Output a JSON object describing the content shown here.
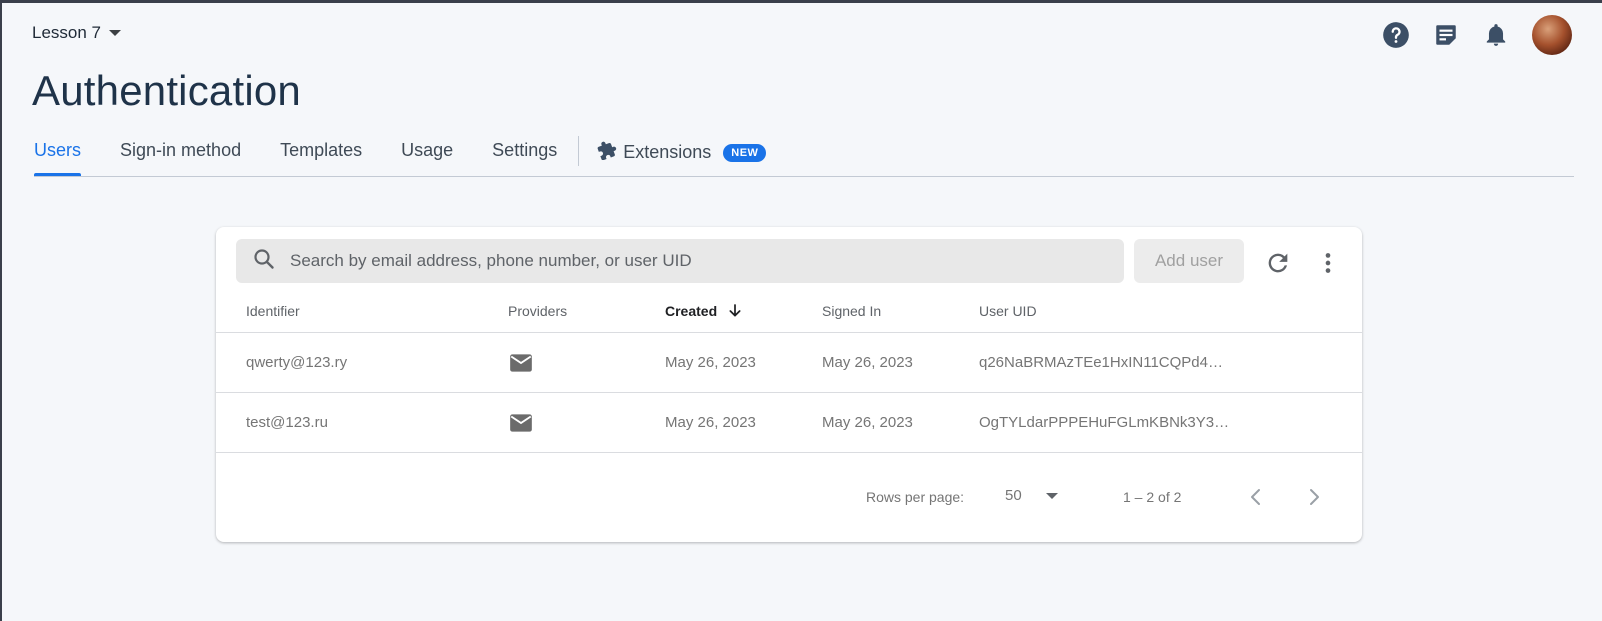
{
  "header": {
    "project_name": "Lesson 7",
    "page_title": "Authentication"
  },
  "tabs": [
    {
      "label": "Users",
      "active": true
    },
    {
      "label": "Sign-in method",
      "active": false
    },
    {
      "label": "Templates",
      "active": false
    },
    {
      "label": "Usage",
      "active": false
    },
    {
      "label": "Settings",
      "active": false
    }
  ],
  "extensions_tab": {
    "label": "Extensions",
    "badge": "NEW"
  },
  "top_icons": [
    "help-icon",
    "release-notes-icon",
    "bell-icon",
    "avatar"
  ],
  "search": {
    "placeholder": "Search by email address, phone number, or user UID",
    "value": ""
  },
  "add_user_label": "Add user",
  "table": {
    "columns": [
      "Identifier",
      "Providers",
      "Created",
      "Signed In",
      "User UID"
    ],
    "sorted_column": "Created",
    "rows": [
      {
        "identifier": "qwerty@123.ry",
        "provider": "email-icon",
        "created": "May 26, 2023",
        "signed_in": "May 26, 2023",
        "uid": "q26NaBRMAzTEe1HxIN11CQPd4…"
      },
      {
        "identifier": "test@123.ru",
        "provider": "email-icon",
        "created": "May 26, 2023",
        "signed_in": "May 26, 2023",
        "uid": "OgTYLdarPPPEHuFGLmKBNk3Y3…"
      }
    ]
  },
  "pagination": {
    "rows_per_page_label": "Rows per page:",
    "rows_per_page_value": "50",
    "range_label": "1 – 2 of 2"
  },
  "colors": {
    "accent": "#1a73e8",
    "title": "#1f3349",
    "background": "#f5f7fa"
  }
}
